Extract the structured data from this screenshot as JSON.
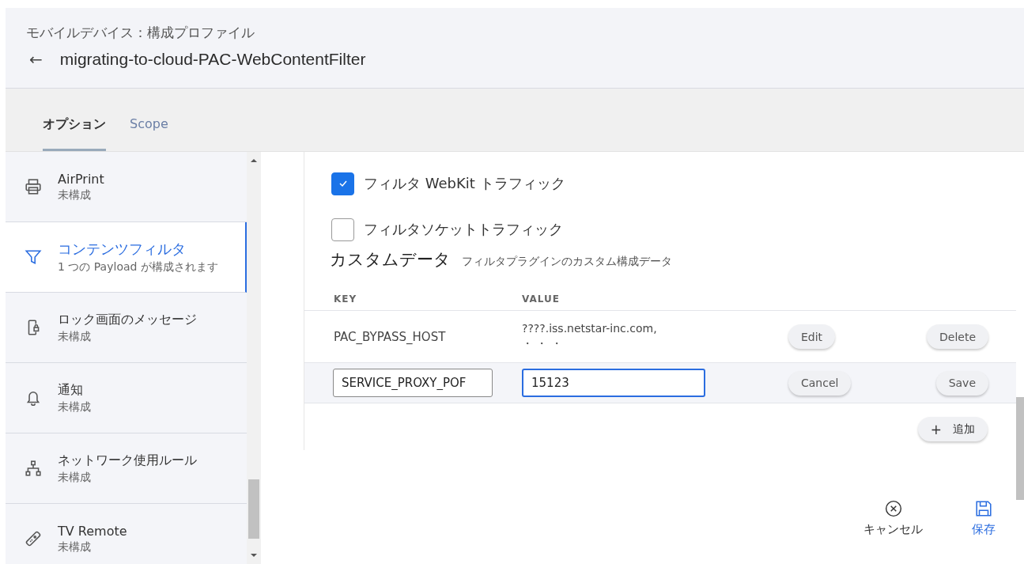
{
  "header": {
    "breadcrumb": "モバイルデバイス：構成プロファイル",
    "back": "←",
    "title": "migrating-to-cloud-PAC-WebContentFilter"
  },
  "tabs": [
    {
      "label": "オプション",
      "selected": true
    },
    {
      "label": "Scope",
      "selected": false
    }
  ],
  "sidebar": {
    "items": [
      {
        "kind": "printer",
        "name": "AirPrint",
        "status": "未構成",
        "selected": false
      },
      {
        "kind": "funnel",
        "name": "コンテンツフィルタ",
        "status": "1 つの Payload が構成されます",
        "selected": true
      },
      {
        "kind": "lock",
        "name": "ロック画面のメッセージ",
        "status": "未構成",
        "selected": false
      },
      {
        "kind": "bell",
        "name": "通知",
        "status": "未構成",
        "selected": false
      },
      {
        "kind": "network",
        "name": "ネットワーク使用ルール",
        "status": "未構成",
        "selected": false
      },
      {
        "kind": "remote",
        "name": "TV Remote",
        "status": "未構成",
        "selected": false
      }
    ]
  },
  "options": [
    {
      "label": "フィルタ WebKit トラフィック",
      "checked": true
    },
    {
      "label": "フィルタソケットトラフィック",
      "checked": false
    }
  ],
  "custom_data": {
    "title": "カスタムデータ",
    "description": "フィルタプラグインのカスタム構成データ",
    "columns": [
      "KEY",
      "VALUE"
    ],
    "rows": [
      {
        "kind": "display",
        "key": "PAC_BYPASS_HOST",
        "value": [
          "????.iss.netstar-inc.com,",
          "・ ・ ・"
        ],
        "actions": [
          "Edit",
          "Delete"
        ]
      },
      {
        "kind": "editing",
        "key": "SERVICE_PROXY_POF",
        "value": [
          "15123"
        ],
        "actions": [
          "Cancel",
          "Save"
        ]
      }
    ],
    "add_button": {
      "icon": "+",
      "label": "追加"
    }
  },
  "footer": {
    "cancel": "キャンセル",
    "save": "保存"
  }
}
